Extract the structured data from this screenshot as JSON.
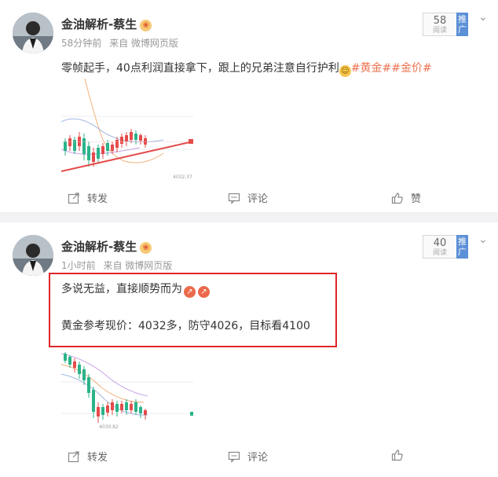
{
  "posts": [
    {
      "author": "金油解析-蔡生",
      "time": "58分钟前",
      "source": "来自 微博网页版",
      "reads": "58",
      "reads_label": "阅读",
      "promote_label": "推广",
      "text_main": "零帧起手，40点利润直接拿下，跟上的兄弟注意自行护利",
      "tags": [
        "#黄金#",
        "#金价#"
      ],
      "chart_stamp": "4032.37",
      "actions": {
        "repost": "转发",
        "comment": "评论",
        "like": "赞"
      }
    },
    {
      "author": "金油解析-蔡生",
      "time": "1小时前",
      "source": "来自 微博网页版",
      "reads": "40",
      "reads_label": "阅读",
      "promote_label": "推广",
      "text_line1": "多说无益，直接顺势而为",
      "text_line2": "黄金参考现价：4032多，防守4026，目标看4100",
      "chart_stamp": "4030.82",
      "actions": {
        "repost": "转发",
        "comment": "评论"
      }
    }
  ],
  "colors": {
    "tag": "#eb7350",
    "highlight_box": "#e0262b",
    "bull_candle": "#e54b4b",
    "bear_candle": "#2bb38a"
  }
}
